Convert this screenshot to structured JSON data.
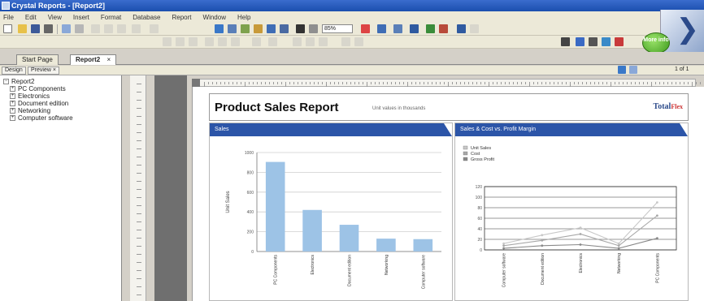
{
  "window": {
    "title": "Crystal Reports - [Report2]"
  },
  "menu": {
    "items": [
      "File",
      "Edit",
      "View",
      "Insert",
      "Format",
      "Database",
      "Report",
      "Window",
      "Help"
    ]
  },
  "toolbar": {
    "zoom": "85%"
  },
  "logo": {
    "more_info": "More info"
  },
  "tabs": [
    {
      "label": "Start Page"
    },
    {
      "label": "Report2",
      "close": "×"
    }
  ],
  "subtabs": {
    "design": "Design",
    "preview": "Preview",
    "close": "×",
    "page": "1 of 1"
  },
  "tree": {
    "root": "Report2",
    "children": [
      "PC Components",
      "Electronics",
      "Document edition",
      "Networking",
      "Computer software"
    ]
  },
  "report": {
    "title": "Product Sales Report",
    "units_note": "Unit values in thousands",
    "brand": "Total",
    "brand_sup": "Flex"
  },
  "chart_left_title": "Sales",
  "chart_right_title": "Sales & Cost vs. Profit Margin",
  "chart_data": [
    {
      "type": "bar",
      "title": "Sales",
      "ylabel": "Unit Sales",
      "categories": [
        "PC Components",
        "Electronics",
        "Document edition",
        "Networking",
        "Computer software"
      ],
      "values": [
        905,
        420,
        270,
        130,
        125
      ],
      "ylim": [
        0,
        1000
      ],
      "yticks": [
        0,
        200,
        400,
        600,
        800,
        1000
      ],
      "grid": true,
      "color": "#9dc3e6"
    },
    {
      "type": "line",
      "title": "Sales & Cost vs. Profit Margin",
      "categories": [
        "Computer software",
        "Document edition",
        "Electronics",
        "Networking",
        "PC Components"
      ],
      "series": [
        {
          "name": "Unit Sales",
          "values": [
            12,
            28,
            42,
            12,
            90
          ]
        },
        {
          "name": "Cost",
          "values": [
            8,
            18,
            30,
            8,
            65
          ]
        },
        {
          "name": "Gross Profit",
          "values": [
            3,
            8,
            10,
            3,
            22
          ]
        }
      ],
      "ylim": [
        0,
        120
      ],
      "yticks": [
        0,
        20,
        40,
        60,
        80,
        100,
        120
      ],
      "legend": "top-left",
      "colors": [
        "#c8c8c8",
        "#a8a8a8",
        "#888888"
      ]
    }
  ]
}
